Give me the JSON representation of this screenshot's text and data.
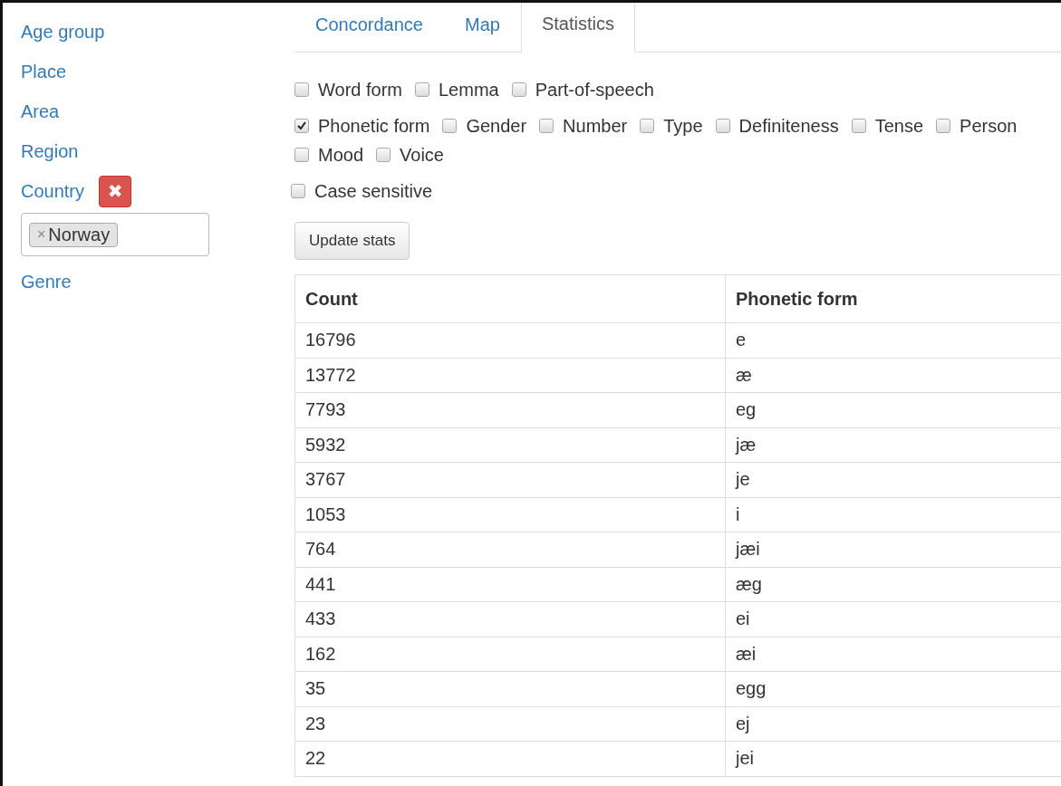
{
  "sidebar": {
    "items": [
      {
        "label": "Age group"
      },
      {
        "label": "Place"
      },
      {
        "label": "Area"
      },
      {
        "label": "Region"
      },
      {
        "label": "Country",
        "remove": "✖",
        "tags": [
          {
            "remove": "×",
            "label": "Norway"
          }
        ]
      },
      {
        "label": "Genre"
      }
    ]
  },
  "tabs": [
    {
      "label": "Concordance",
      "selected": false
    },
    {
      "label": "Map",
      "selected": false
    },
    {
      "label": "Statistics",
      "selected": true
    }
  ],
  "checkbox_groups": [
    [
      [
        {
          "label": "Word form",
          "checked": false
        },
        {
          "label": "Lemma",
          "checked": false
        },
        {
          "label": "Part-of-speech",
          "checked": false
        }
      ]
    ],
    [
      [
        {
          "label": "Phonetic form",
          "checked": true
        },
        {
          "label": "Gender",
          "checked": false
        },
        {
          "label": "Number",
          "checked": false
        },
        {
          "label": "Type",
          "checked": false
        },
        {
          "label": "Definiteness",
          "checked": false
        },
        {
          "label": "Tense",
          "checked": false
        },
        {
          "label": "Person",
          "checked": false
        }
      ],
      [
        {
          "label": "Mood",
          "checked": false
        },
        {
          "label": "Voice",
          "checked": false
        }
      ]
    ]
  ],
  "case_sensitive": {
    "label": "Case sensitive",
    "checked": false
  },
  "update_button": "Update stats",
  "table": {
    "columns": [
      "Count",
      "Phonetic form"
    ],
    "rows": [
      [
        "16796",
        "e"
      ],
      [
        "13772",
        "æ"
      ],
      [
        "7793",
        "eg"
      ],
      [
        "5932",
        "jæ"
      ],
      [
        "3767",
        "je"
      ],
      [
        "1053",
        "i"
      ],
      [
        "764",
        "jæi"
      ],
      [
        "441",
        "æg"
      ],
      [
        "433",
        "ei"
      ],
      [
        "162",
        "æi"
      ],
      [
        "35",
        "egg"
      ],
      [
        "23",
        "ej"
      ],
      [
        "22",
        "jei"
      ]
    ]
  }
}
